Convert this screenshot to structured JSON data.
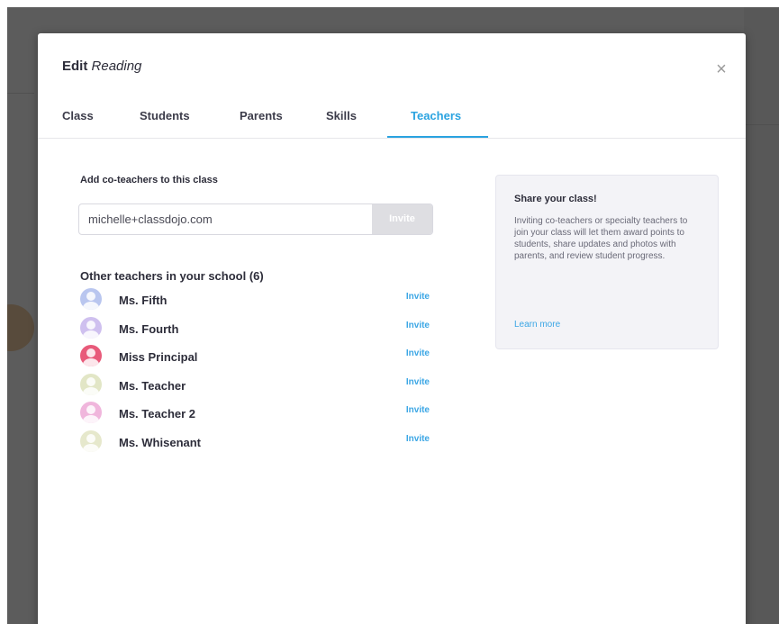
{
  "modal": {
    "title_prefix": "Edit",
    "title_class": "Reading",
    "close_symbol": "×"
  },
  "tabs": [
    {
      "label": "Class"
    },
    {
      "label": "Students"
    },
    {
      "label": "Parents"
    },
    {
      "label": "Skills"
    },
    {
      "label": "Teachers",
      "active": true
    }
  ],
  "add_coteachers": {
    "label": "Add co-teachers to this class",
    "input_value": "michelle+classdojo.com",
    "invite_button": "Invite"
  },
  "other_teachers": {
    "heading": "Other teachers in your school (6)",
    "items": [
      {
        "name": "Ms. Fifth",
        "invite_label": "Invite",
        "avatar_color": "#b9c6ef"
      },
      {
        "name": "Ms. Fourth",
        "invite_label": "Invite",
        "avatar_color": "#cfc0ef"
      },
      {
        "name": "Miss Principal",
        "invite_label": "Invite",
        "avatar_color": "#e85a7a"
      },
      {
        "name": "Ms. Teacher",
        "invite_label": "Invite",
        "avatar_color": "#e2e6c6"
      },
      {
        "name": "Ms. Teacher 2",
        "invite_label": "Invite",
        "avatar_color": "#f0b6dc"
      },
      {
        "name": "Ms. Whisenant",
        "invite_label": "Invite",
        "avatar_color": "#e6e8cc"
      }
    ]
  },
  "share_card": {
    "title": "Share your class!",
    "text": "Inviting co-teachers or specialty teachers to join your class will let them award points to students, share updates and photos with parents, and review student progress.",
    "link": "Learn more"
  },
  "colors": {
    "accent": "#2aa3e0",
    "overlay": "#1e1e1e"
  }
}
